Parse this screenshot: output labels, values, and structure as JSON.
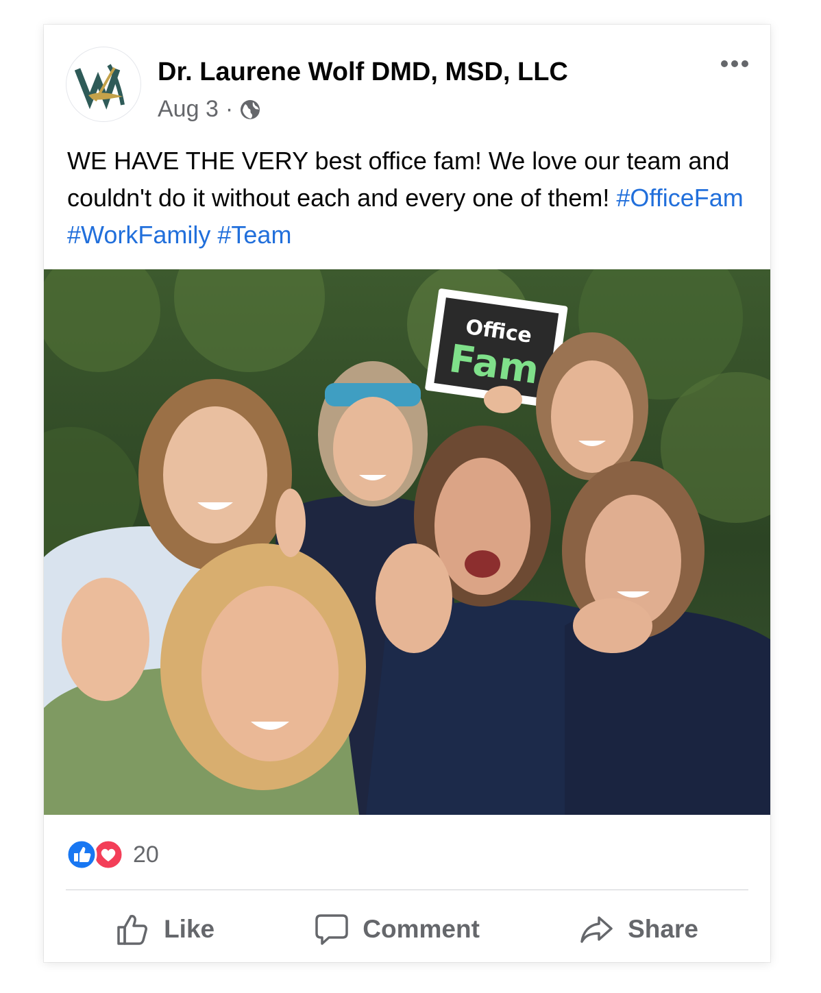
{
  "post": {
    "author": "Dr. Laurene Wolf DMD, MSD, LLC",
    "date": "Aug 3",
    "separator": "·",
    "audience_icon": "globe-icon",
    "text": "WE HAVE THE VERY best office fam! We love our team and couldn't do it without each and every one of them!",
    "hashtags": [
      "#OfficeFam",
      "#WorkFamily",
      "#Team"
    ],
    "menu_icon": "more-options-icon"
  },
  "photo": {
    "sign_line1": "Office",
    "sign_line2": "Fam"
  },
  "reactions": {
    "icons": [
      "like-reaction-icon",
      "love-reaction-icon"
    ],
    "count": "20"
  },
  "actions": {
    "like": "Like",
    "comment": "Comment",
    "share": "Share"
  },
  "colors": {
    "hashtag": "#216fdb",
    "like_blue": "#1877f2",
    "love_red": "#f33e58",
    "secondary_text": "#65676b"
  }
}
